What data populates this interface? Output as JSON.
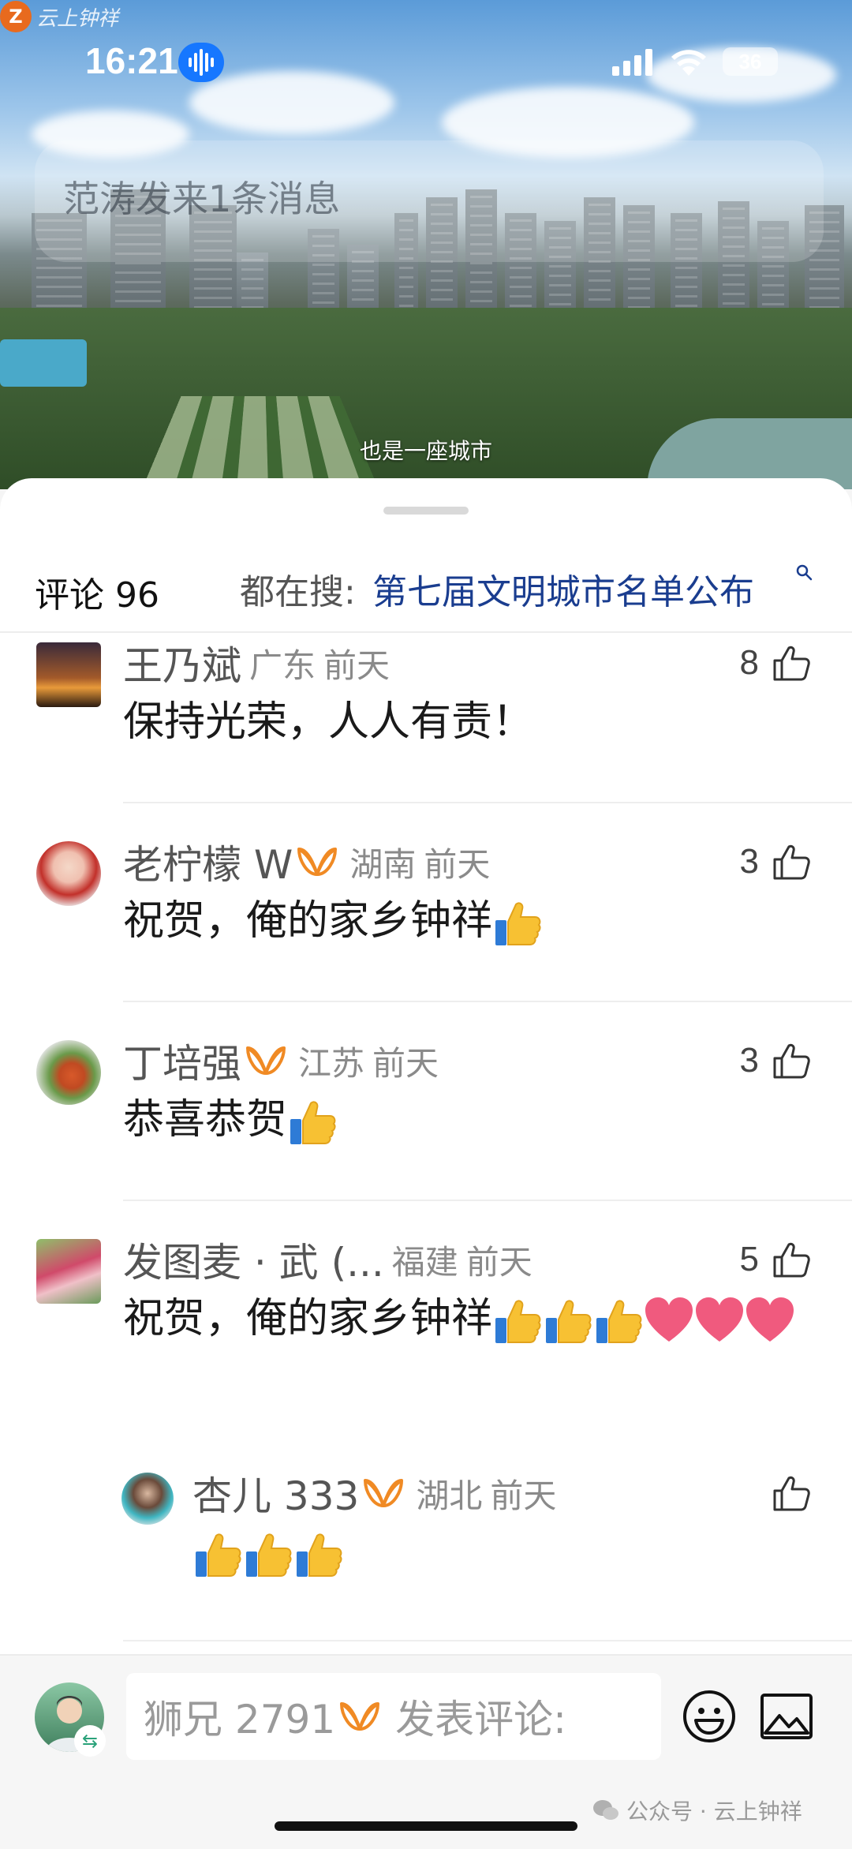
{
  "watermark_top": {
    "logo": "Z",
    "text": "云上钟祥"
  },
  "status_bar": {
    "time": "16:21",
    "battery": "36"
  },
  "notification": {
    "text": "范涛发来1条消息"
  },
  "video": {
    "subtitle": "也是一座城市"
  },
  "comments_header": {
    "count_label": "评论 96",
    "search_prefix": "都在搜:",
    "search_term": "第七届文明城市名单公布"
  },
  "comments": [
    {
      "user": "王乃斌",
      "vip": false,
      "region": "广东",
      "time": "前天",
      "likes": "8",
      "text": "保持光荣，人人有责！"
    },
    {
      "user": "老柠檬 W",
      "vip": true,
      "region": "湖南",
      "time": "前天",
      "likes": "3",
      "text": "祝贺，俺的家乡钟祥"
    },
    {
      "user": "丁培强",
      "vip": true,
      "region": "江苏",
      "time": "前天",
      "likes": "3",
      "text": "恭喜恭贺"
    },
    {
      "user": "发图麦 · 武 (...",
      "vip": false,
      "region": "福建",
      "time": "前天",
      "likes": "5",
      "text": "祝贺，俺的家乡钟祥"
    },
    {
      "user": "杏儿 333",
      "vip": true,
      "region": "湖北",
      "time": "前天",
      "likes": "",
      "text": ""
    }
  ],
  "input_bar": {
    "username": "狮兄 2791",
    "placeholder": "发表评论:"
  },
  "footer_watermark": {
    "text": "公众号 · 云上钟祥"
  },
  "colors": {
    "accent_blue": "#1a3d8f",
    "vip_orange": "#f08a24",
    "voice_blue": "#1677ff"
  }
}
